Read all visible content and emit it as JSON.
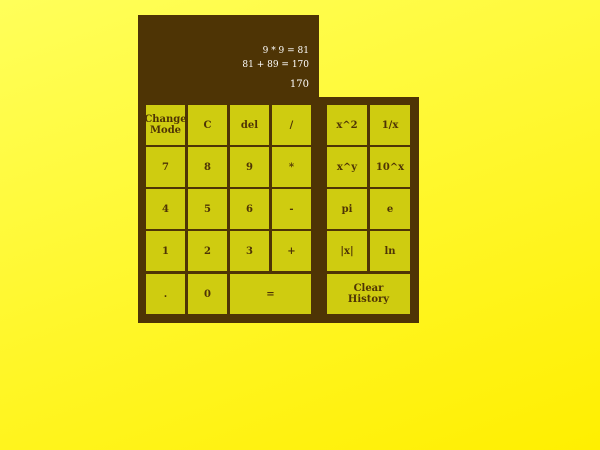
{
  "display": {
    "history": [
      "9 * 9 = 81",
      "81 + 89 = 170"
    ],
    "result": "170"
  },
  "keys": {
    "change_mode": "Change\nMode",
    "clear": "C",
    "del": "del",
    "divide": "/",
    "seven": "7",
    "eight": "8",
    "nine": "9",
    "multiply": "*",
    "four": "4",
    "five": "5",
    "six": "6",
    "minus": "-",
    "one": "1",
    "two": "2",
    "three": "3",
    "plus": "+",
    "dot": ".",
    "zero": "0",
    "equals": "="
  },
  "sci_keys": {
    "square": "x^2",
    "reciprocal": "1/x",
    "power": "x^y",
    "ten_power": "10^x",
    "pi": "pi",
    "e": "e",
    "abs": "|x|",
    "ln": "ln",
    "clear_history": "Clear\nHistory"
  }
}
